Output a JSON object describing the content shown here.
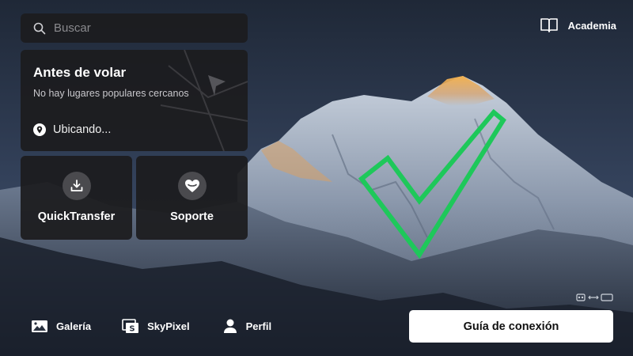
{
  "search": {
    "placeholder": "Buscar",
    "icon": "search-icon"
  },
  "before_flight": {
    "title": "Antes de volar",
    "subtitle": "No hay lugares populares cercanos",
    "location_status": "Ubicando...",
    "location_icon": "location-pin-icon"
  },
  "tiles": [
    {
      "label": "QuickTransfer",
      "icon": "download-tray-icon"
    },
    {
      "label": "Soporte",
      "icon": "heart-icon"
    }
  ],
  "academy": {
    "label": "Academia",
    "icon": "book-icon"
  },
  "bottom_nav": {
    "gallery": "Galería",
    "skypixel": "SkyPixel",
    "profile": "Perfil"
  },
  "connect_button": "Guía de conexión",
  "overlay": {
    "checkmark_color": "#1ec85a"
  }
}
